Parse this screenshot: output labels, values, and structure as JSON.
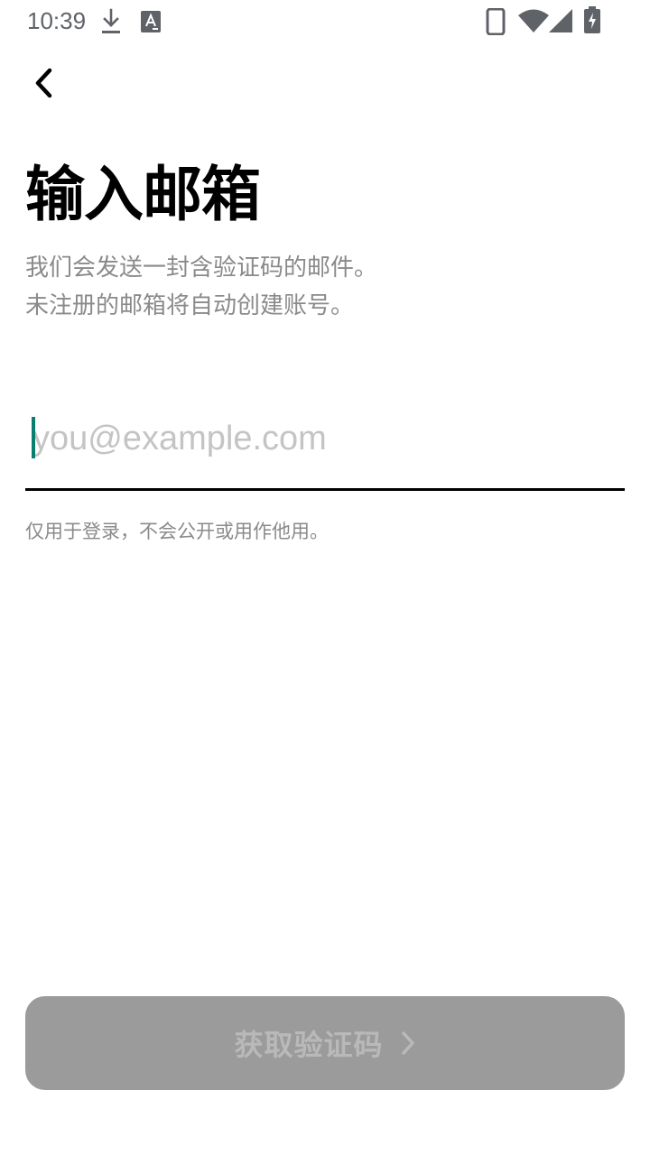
{
  "status_bar": {
    "time": "10:39",
    "icons": [
      "download-icon",
      "text-notification-icon",
      "phone-vibrate-icon",
      "wifi-icon",
      "cell-signal-icon",
      "battery-charging-icon"
    ]
  },
  "nav": {
    "back_icon": "chevron-left-icon"
  },
  "page": {
    "title": "输入邮箱",
    "subtitle_line1": "我们会发送一封含验证码的邮件。",
    "subtitle_line2": "未注册的邮箱将自动创建账号。"
  },
  "email": {
    "value": "",
    "placeholder": "you@example.com",
    "helper": "仅用于登录，不会公开或用作他用。"
  },
  "submit": {
    "label": "获取验证码",
    "icon": "chevron-right-icon",
    "enabled": false
  },
  "colors": {
    "accent_cursor": "#0a7f70",
    "button_disabled_bg": "#9b9b9b",
    "button_disabled_text": "#b9b9b9",
    "secondary_text": "#8a8a8a"
  }
}
